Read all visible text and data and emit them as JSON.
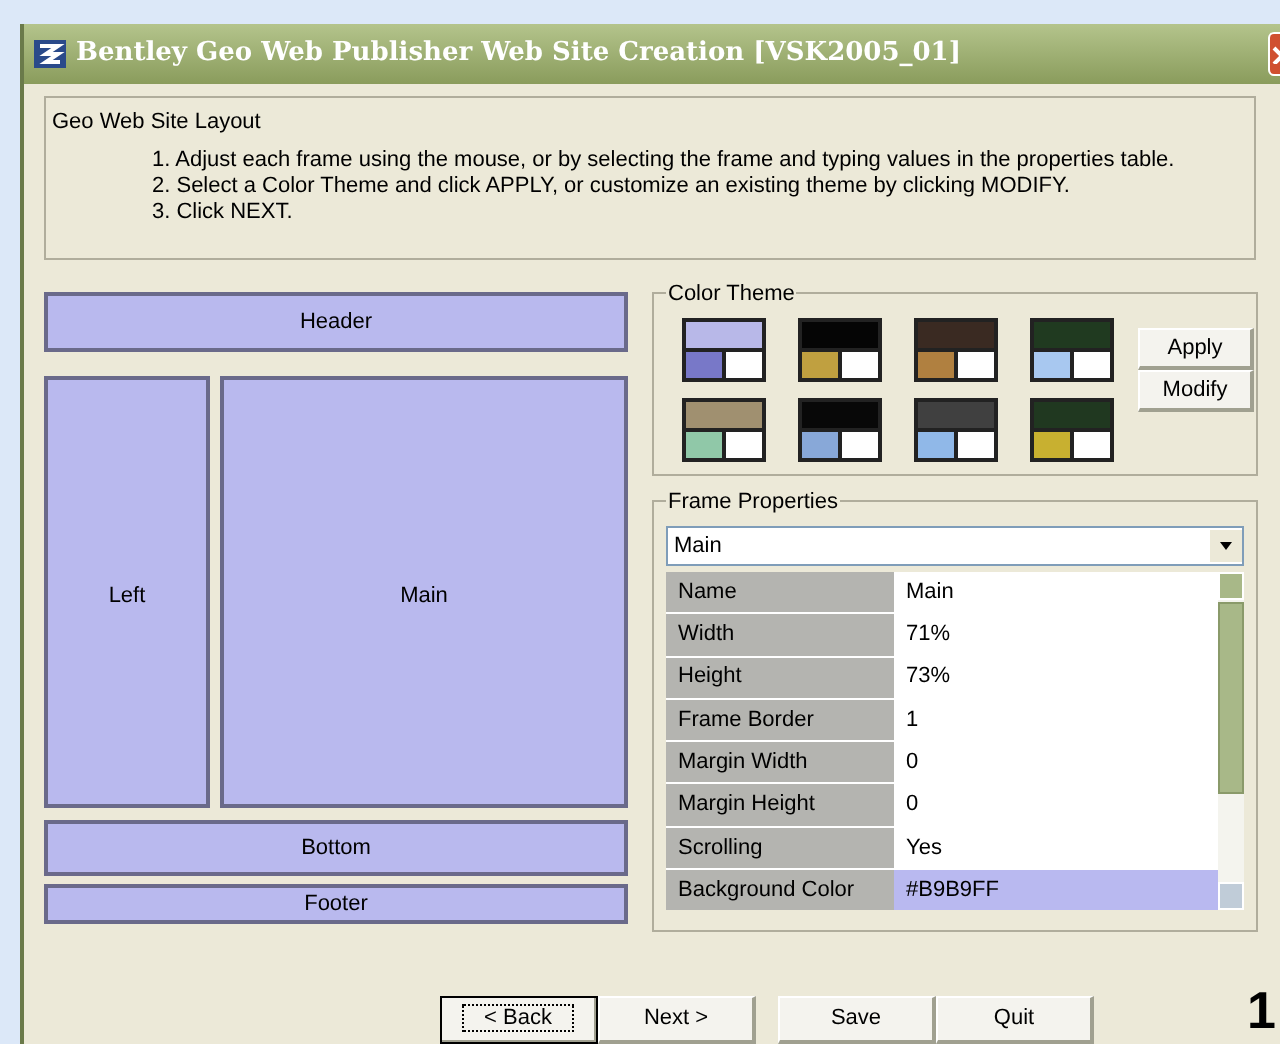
{
  "window": {
    "title": "Bentley Geo Web Publisher Web Site Creation  [VSK2005_01]"
  },
  "instructions": {
    "title": "Geo Web Site Layout",
    "steps": [
      "1. Adjust each frame using the mouse, or by selecting the frame and typing values in the properties table.",
      "2. Select a Color Theme and click APPLY, or customize an existing theme by clicking MODIFY.",
      "3. Click NEXT."
    ]
  },
  "layout_frames": {
    "header": "Header",
    "left": "Left",
    "main": "Main",
    "bottom": "Bottom",
    "footer": "Footer"
  },
  "color_theme": {
    "title": "Color Theme",
    "themes": [
      {
        "parts": [
          {
            "color": "#b8b8e8"
          },
          {
            "color": "#7878c8"
          },
          {
            "color": "#ffffff"
          }
        ]
      },
      {
        "parts": [
          {
            "color": "#050505"
          },
          {
            "color": "#c0a040"
          },
          {
            "color": "#ffffff"
          }
        ]
      },
      {
        "parts": [
          {
            "color": "#3a2a22"
          },
          {
            "color": "#b08040"
          },
          {
            "color": "#ffffff"
          }
        ]
      },
      {
        "parts": [
          {
            "color": "#203a20"
          },
          {
            "color": "#a8c8f0"
          },
          {
            "color": "#ffffff"
          }
        ]
      },
      {
        "parts": [
          {
            "color": "#a09070"
          },
          {
            "color": "#90c8a8"
          },
          {
            "color": "#ffffff"
          }
        ]
      },
      {
        "parts": [
          {
            "color": "#080808"
          },
          {
            "color": "#88a8d8"
          },
          {
            "color": "#ffffff"
          }
        ]
      },
      {
        "parts": [
          {
            "color": "#404040"
          },
          {
            "color": "#90b8e8"
          },
          {
            "color": "#ffffff"
          }
        ]
      },
      {
        "parts": [
          {
            "color": "#203820"
          },
          {
            "color": "#c8b030"
          },
          {
            "color": "#ffffff"
          }
        ]
      }
    ],
    "buttons": [
      "Apply",
      "Modify"
    ]
  },
  "frame_properties": {
    "title": "Frame Properties",
    "frame": "Main",
    "rows": [
      {
        "name": "Name",
        "value": "Main",
        "selected": false
      },
      {
        "name": "Width",
        "value": "71%",
        "selected": false
      },
      {
        "name": "Height",
        "value": "73%",
        "selected": false
      },
      {
        "name": "Frame Border",
        "value": "1",
        "selected": false
      },
      {
        "name": "Margin Width",
        "value": "0",
        "selected": false
      },
      {
        "name": "Margin Height",
        "value": "0",
        "selected": false
      },
      {
        "name": "Scrolling",
        "value": "Yes",
        "selected": false
      },
      {
        "name": "Background Color",
        "value": "#B9B9FF",
        "selected": true
      }
    ]
  },
  "buttons": [
    {
      "label": "< Back",
      "focused": true
    },
    {
      "label": "Next >",
      "focused": false
    },
    {
      "label": "Save",
      "focused": false
    },
    {
      "label": "Quit",
      "focused": false
    }
  ],
  "page_number": "1"
}
